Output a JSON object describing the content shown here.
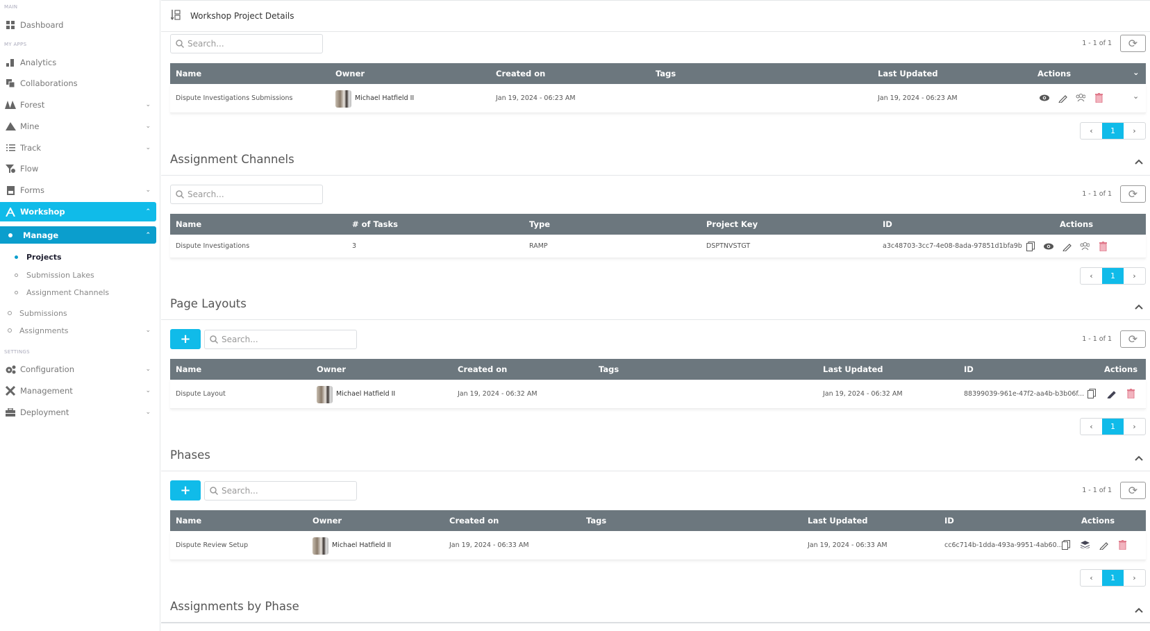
{
  "sidebar": {
    "sections": {
      "main": "MAIN",
      "my_apps": "MY APPS",
      "settings": "SETTINGS"
    },
    "items": {
      "dashboard": "Dashboard",
      "analytics": "Analytics",
      "collaborations": "Collaborations",
      "forest": "Forest",
      "mine": "Mine",
      "track": "Track",
      "flow": "Flow",
      "forms": "Forms",
      "workshop": "Workshop",
      "manage": "Manage",
      "projects": "Projects",
      "submission_lakes": "Submission Lakes",
      "assignment_channels": "Assignment Channels",
      "submissions": "Submissions",
      "assignments": "Assignments",
      "configuration": "Configuration",
      "management": "Management",
      "deployment": "Deployment"
    },
    "active_item": "Projects",
    "accent_color": "#10bbe9",
    "manage_color": "#0b9ecd"
  },
  "header": {
    "title": "Workshop Project Details"
  },
  "search_placeholder": "Search...",
  "projects": {
    "count": "1 - 1 of 1",
    "columns": [
      "Name",
      "Owner",
      "Created on",
      "Tags",
      "Last Updated",
      "Actions"
    ],
    "rows": [
      {
        "name": "Dispute Investigations Submissions",
        "owner": "Michael Hatfield II",
        "created": "Jan 19, 2024 - 06:23 AM",
        "tags": "",
        "updated": "Jan 19, 2024 - 06:23 AM",
        "actions": [
          "eye-icon",
          "pencil-icon",
          "users-icon",
          "trash-icon"
        ]
      }
    ],
    "page": "1"
  },
  "assignment_channels": {
    "title": "Assignment Channels",
    "count": "1 - 1 of 1",
    "columns": [
      "Name",
      "# of Tasks",
      "Type",
      "Project Key",
      "ID",
      "Actions"
    ],
    "rows": [
      {
        "name": "Dispute Investigations",
        "tasks": "3",
        "type": "RAMP",
        "key": "DSPTNVSTGT",
        "id": "a3c48703-3cc7-4e08-8ada-97851d1bfa9b",
        "actions": [
          "copy-icon",
          "eye-icon",
          "pencil-icon",
          "users-icon",
          "trash-icon"
        ]
      }
    ],
    "page": "1"
  },
  "page_layouts": {
    "title": "Page Layouts",
    "add_label": "+",
    "count": "1 - 1 of 1",
    "columns": [
      "Name",
      "Owner",
      "Created on",
      "Tags",
      "Last Updated",
      "ID",
      "Actions"
    ],
    "rows": [
      {
        "name": "Dispute Layout",
        "owner": "Michael Hatfield II",
        "created": "Jan 19, 2024 - 06:32 AM",
        "tags": "",
        "updated": "Jan 19, 2024 - 06:32 AM",
        "id": "88399039-961e-47f2-aa4b-b3b06f...",
        "actions": [
          "copy-icon",
          "pencil-icon",
          "trash-icon"
        ]
      }
    ],
    "page": "1"
  },
  "phases": {
    "title": "Phases",
    "add_label": "+",
    "count": "1 - 1 of 1",
    "columns": [
      "Name",
      "Owner",
      "Created on",
      "Tags",
      "Last Updated",
      "ID",
      "Actions"
    ],
    "rows": [
      {
        "name": "Dispute Review Setup",
        "owner": "Michael Hatfield II",
        "created": "Jan 19, 2024 - 06:33 AM",
        "tags": "",
        "updated": "Jan 19, 2024 - 06:33 AM",
        "id": "cc6c714b-1dda-493a-9951-4ab60...",
        "actions": [
          "copy-icon",
          "layers-icon",
          "pencil-icon",
          "trash-icon"
        ]
      }
    ],
    "page": "1"
  },
  "assignments_by_phase": {
    "title": "Assignments by Phase"
  },
  "pager": {
    "prev": "‹",
    "next": "›"
  }
}
